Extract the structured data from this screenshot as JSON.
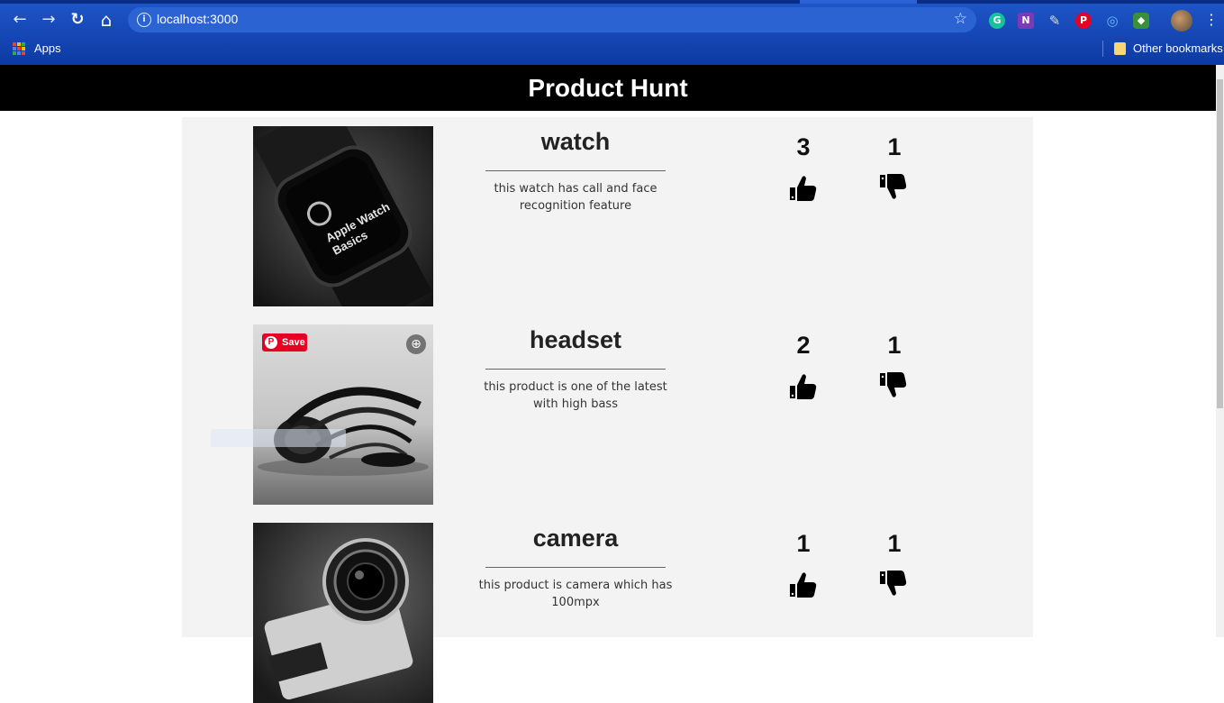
{
  "browser": {
    "url": "localhost:3000",
    "bookmarks": {
      "apps_label": "Apps",
      "other_label": "Other bookmarks"
    },
    "nav": {
      "back": "←",
      "forward": "→",
      "reload": "↻",
      "home": "⌂"
    }
  },
  "page": {
    "title": "Product Hunt"
  },
  "products": [
    {
      "name": "watch",
      "description": "this watch has call and face recognition feature",
      "upvotes": "3",
      "downvotes": "1"
    },
    {
      "name": "headset",
      "description": "this product is one of the latest with high bass",
      "upvotes": "2",
      "downvotes": "1",
      "pinterest_save_label": "Save"
    },
    {
      "name": "camera",
      "description": "this product is camera which has 100mpx",
      "upvotes": "1",
      "downvotes": "1"
    }
  ],
  "colors": {
    "chrome_blue": "#1f56c9",
    "header_bg": "#000000",
    "content_bg": "#f3f3f3",
    "pinterest_red": "#e60023"
  }
}
